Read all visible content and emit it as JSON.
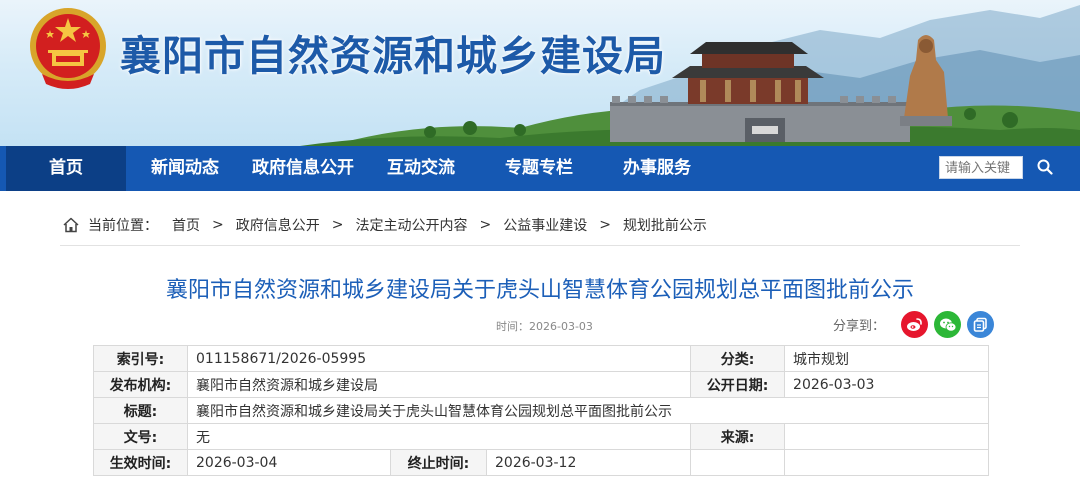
{
  "header": {
    "site_title": "襄阳市自然资源和城乡建设局",
    "emblem_icon": "national-emblem-icon"
  },
  "nav": {
    "items": [
      {
        "label": "首页",
        "active": true
      },
      {
        "label": "新闻动态",
        "active": false
      },
      {
        "label": "政府信息公开",
        "active": false
      },
      {
        "label": "互动交流",
        "active": false
      },
      {
        "label": "专题专栏",
        "active": false
      },
      {
        "label": "办事服务",
        "active": false
      }
    ],
    "search": {
      "placeholder": "请输入关键",
      "icon": "search-icon"
    }
  },
  "breadcrumb": {
    "label": "当前位置：",
    "items": [
      "首页",
      "政府信息公开",
      "法定主动公开内容",
      "公益事业建设",
      "规划批前公示"
    ],
    "separator": ">"
  },
  "article": {
    "title": "襄阳市自然资源和城乡建设局关于虎头山智慧体育公园规划总平面图批前公示",
    "time": "时间：2026-03-03",
    "share_label": "分享到：",
    "share_icons": [
      "weibo-icon",
      "wechat-icon",
      "copy-icon"
    ]
  },
  "info": {
    "index_label": "索引号:",
    "index_value": "011158671/2026-05995",
    "category_label": "分类:",
    "category_value": "城市规划",
    "publisher_label": "发布机构:",
    "publisher_value": "襄阳市自然资源和城乡建设局",
    "date_label": "公开日期:",
    "date_value": "2026-03-03",
    "title_label": "标题:",
    "title_value": "襄阳市自然资源和城乡建设局关于虎头山智慧体育公园规划总平面图批前公示",
    "doc_no_label": "文号:",
    "doc_no_value": "无",
    "source_label": "来源:",
    "source_value": "",
    "effective_label": "生效时间:",
    "effective_value": "2026-03-04",
    "end_label": "终止时间:",
    "end_value": "2026-03-12"
  },
  "colors": {
    "nav_bg": "#1558b3",
    "nav_active": "#0c3f86",
    "title_blue": "#1c5fb8",
    "weibo": "#e6162d",
    "wechat": "#2cb737",
    "copy": "#3a86d8"
  }
}
